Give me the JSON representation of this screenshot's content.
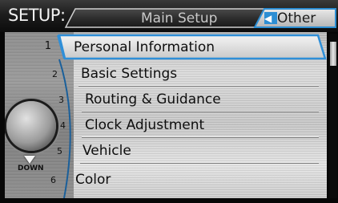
{
  "header": {
    "title": "SETUP:",
    "tabs": [
      {
        "label": "Main Setup",
        "active": false
      },
      {
        "label": "Other",
        "active": true
      }
    ]
  },
  "menu": {
    "items": [
      {
        "num": "1",
        "label": "Personal Information",
        "selected": true
      },
      {
        "num": "2",
        "label": "Basic Settings",
        "selected": false
      },
      {
        "num": "3",
        "label": "Routing & Guidance",
        "selected": false
      },
      {
        "num": "4",
        "label": "Clock Adjustment",
        "selected": false
      },
      {
        "num": "5",
        "label": "Vehicle",
        "selected": false
      },
      {
        "num": "6",
        "label": "Color",
        "selected": false
      }
    ]
  },
  "dial": {
    "down_label": "DOWN"
  },
  "colors": {
    "highlight_border": "#2f8fd8",
    "active_tab": "#2d8ed3"
  }
}
